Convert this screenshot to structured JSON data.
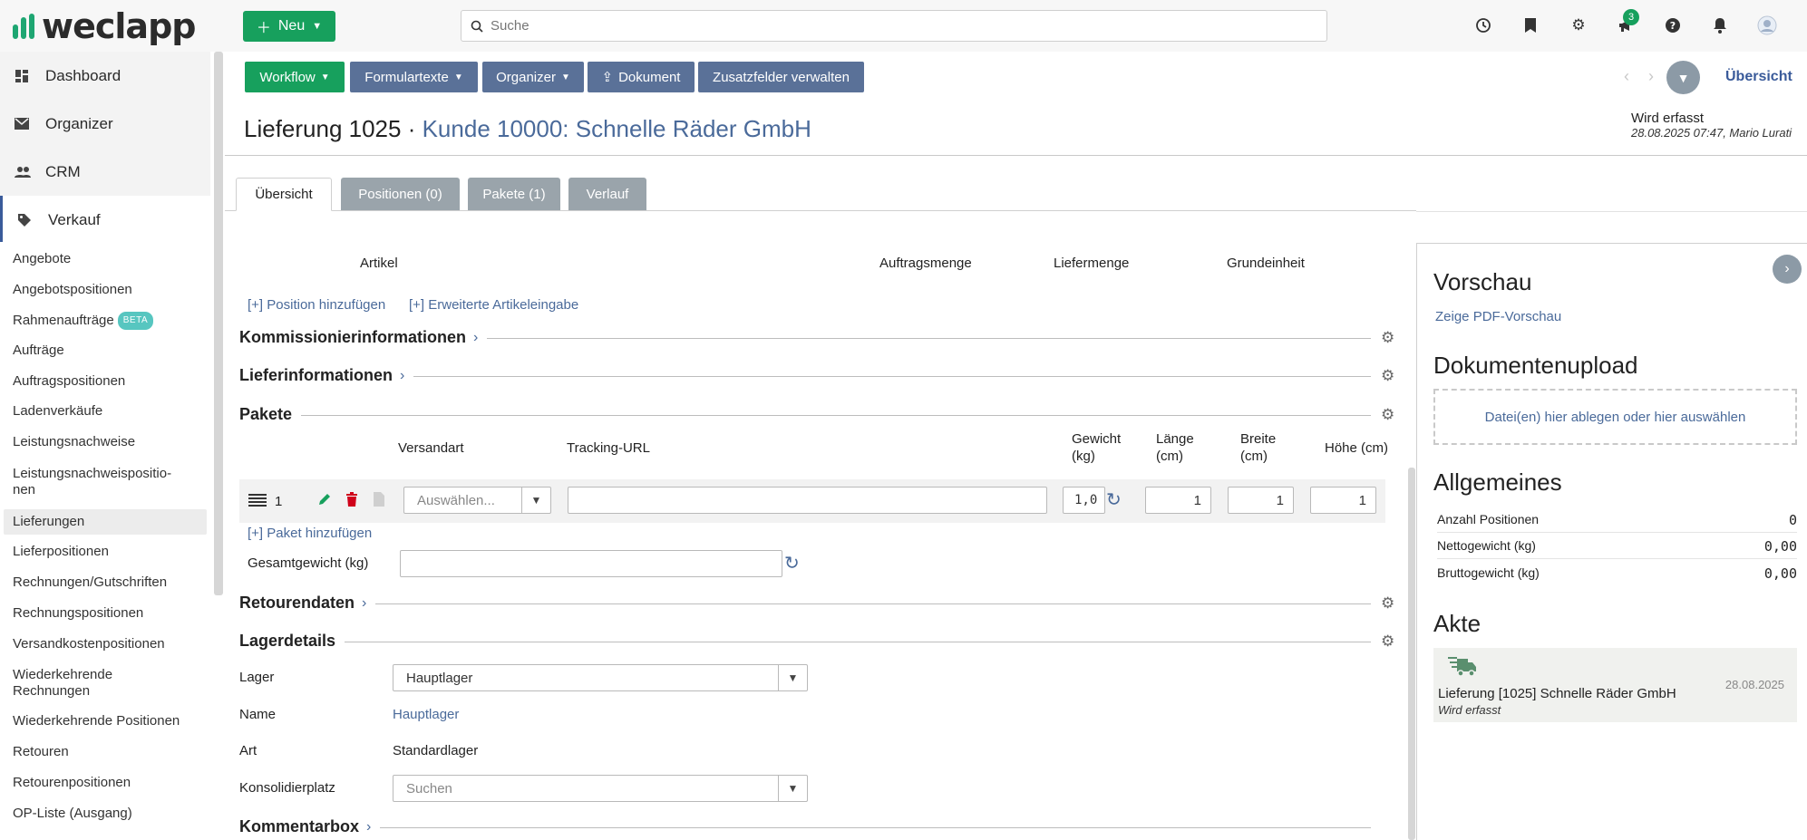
{
  "app": {
    "logo": "weclapp"
  },
  "topbar": {
    "new_label": "Neu",
    "search_placeholder": "Suche",
    "notification_count": "3"
  },
  "sidebar": {
    "main": [
      {
        "label": "Dashboard"
      },
      {
        "label": "Organizer"
      },
      {
        "label": "CRM"
      },
      {
        "label": "Verkauf"
      }
    ],
    "sub": [
      "Angebote",
      "Angebotspositionen",
      "Rahmenaufträge",
      "Aufträge",
      "Auftragspositionen",
      "Ladenverkäufe",
      "Leistungsnachweise",
      "Leistungsnachweispositio-",
      "nen",
      "Lieferungen",
      "Lieferpositionen",
      "Rechnungen/Gutschriften",
      "Rechnungspositionen",
      "Versandkostenpositionen",
      "Wiederkehrende",
      "Rechnungen",
      "Wiederkehrende Positionen",
      "Retouren",
      "Retourenpositionen",
      "OP-Liste (Ausgang)"
    ],
    "beta_badge": "BETA"
  },
  "toolbar": {
    "workflow": "Workflow",
    "formulartexte": "Formulartexte",
    "organizer": "Organizer",
    "dokument": "Dokument",
    "zusatzfelder": "Zusatzfelder verwalten",
    "overview": "Übersicht"
  },
  "header": {
    "title": "Lieferung 1025 · ",
    "customer": "Kunde 10000: Schnelle Räder GmbH",
    "status": "Wird erfasst",
    "status_meta": "28.08.2025 07:47, Mario Lurati"
  },
  "tabs": [
    {
      "label": "Übersicht"
    },
    {
      "label": "Positionen (0)"
    },
    {
      "label": "Pakete (1)"
    },
    {
      "label": "Verlauf"
    }
  ],
  "positions": {
    "headers": [
      "Artikel",
      "Auftragsmenge",
      "Liefermenge",
      "Grundeinheit"
    ],
    "add_position": "[+] Position hinzufügen",
    "advanced_entry": "[+] Erweiterte Artikeleingabe"
  },
  "sections": {
    "kommission": "Kommissionierinformationen",
    "liefer": "Lieferinformationen",
    "pakete": "Pakete",
    "retouren": "Retourendaten",
    "lager": "Lagerdetails",
    "kommentar": "Kommentarbox"
  },
  "packages": {
    "headers": {
      "versandart": "Versandart",
      "tracking": "Tracking-URL",
      "gewicht_1": "Gewicht",
      "gewicht_2": "(kg)",
      "laenge_1": "Länge",
      "laenge_2": "(cm)",
      "breite_1": "Breite",
      "breite_2": "(cm)",
      "hoehe": "Höhe (cm)"
    },
    "row": {
      "number": "1",
      "versandart_placeholder": "Auswählen...",
      "tracking_value": "",
      "weight": "1,0",
      "length": "1",
      "width": "1",
      "height": "1"
    },
    "add_package": "[+] Paket hinzufügen",
    "total_weight_label": "Gesamtgewicht (kg)",
    "total_weight_value": ""
  },
  "lager": {
    "lager_label": "Lager",
    "lager_value": "Hauptlager",
    "name_label": "Name",
    "name_value": "Hauptlager",
    "art_label": "Art",
    "art_value": "Standardlager",
    "konsol_label": "Konsolidierplatz",
    "konsol_placeholder": "Suchen"
  },
  "right": {
    "preview_title": "Vorschau",
    "preview_link": "Zeige PDF-Vorschau",
    "upload_title": "Dokumentenupload",
    "dropzone": "Datei(en) hier ablegen oder hier auswählen",
    "general_title": "Allgemeines",
    "general": [
      {
        "k": "Anzahl Positionen",
        "v": "0"
      },
      {
        "k": "Nettogewicht (kg)",
        "v": "0,00"
      },
      {
        "k": "Bruttogewicht (kg)",
        "v": "0,00"
      }
    ],
    "akte_title": "Akte",
    "akte_entry": "Lieferung [1025] Schnelle Räder GmbH",
    "akte_status": "Wird erfasst",
    "akte_date": "28.08.2025"
  },
  "colors": {
    "green": "#17a05d",
    "blue": "#5a7198",
    "link": "#4a6a9a"
  }
}
